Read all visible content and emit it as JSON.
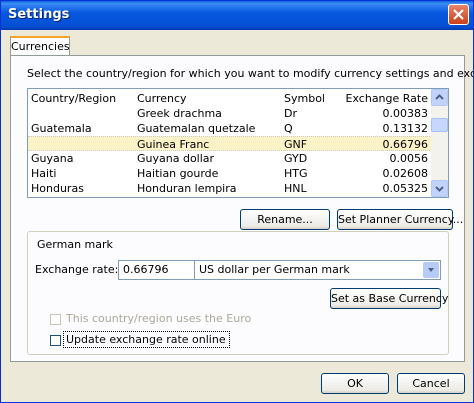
{
  "window": {
    "title": "Settings"
  },
  "tabs": [
    {
      "label": "Currencies"
    }
  ],
  "panel": {
    "instruction": "Select the country/region for which you want to modify currency settings and exchange rates."
  },
  "list": {
    "columns": [
      "Country/Region",
      "Currency",
      "Symbol",
      "Exchange Rate"
    ],
    "rows": [
      {
        "country": "",
        "currency": "Greek drachma",
        "symbol": "Dr",
        "rate": "0.00383"
      },
      {
        "country": "Guatemala",
        "currency": "Guatemalan quetzale",
        "symbol": "Q",
        "rate": "0.13132"
      },
      {
        "country": "",
        "currency": "Guinea Franc",
        "symbol": "GNF",
        "rate": "0.66796"
      },
      {
        "country": "Guyana",
        "currency": "Guyana dollar",
        "symbol": "GYD",
        "rate": "0.0056"
      },
      {
        "country": "Haiti",
        "currency": "Haitian gourde",
        "symbol": "HTG",
        "rate": "0.02608"
      },
      {
        "country": "Honduras",
        "currency": "Honduran lempira",
        "symbol": "HNL",
        "rate": "0.05325"
      }
    ],
    "selected_index": 2
  },
  "buttons": {
    "rename": "Rename...",
    "set_planner": "Set Planner Currency...",
    "set_base": "Set as Base Currency",
    "ok": "OK",
    "cancel": "Cancel"
  },
  "details": {
    "group_title": "German mark",
    "exchange_rate_label": "Exchange rate:",
    "exchange_rate_value": "0.66796",
    "unit_selected": "US dollar per German mark",
    "euro_checkbox_label": "This country/region uses the Euro",
    "euro_checked": false,
    "online_checkbox_label": "Update exchange rate online",
    "online_checked": false
  },
  "colors": {
    "title_bar": "#0350d4",
    "selected_row": "#fcf2c8",
    "dialog_bg": "#ece9d8"
  }
}
